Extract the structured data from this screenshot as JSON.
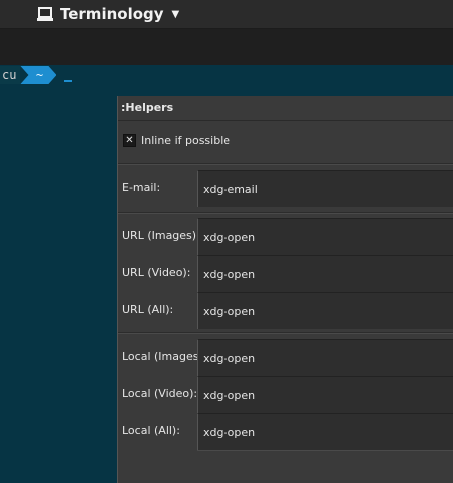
{
  "topbar": {
    "app_menu_label": "Terminology",
    "app_icon": "laptop-icon",
    "caret_icon": "chevron-down-icon"
  },
  "terminal": {
    "prompt_user": "cu",
    "prompt_dir": "~",
    "cursor_glyph": "_",
    "colors": {
      "background": "#063444",
      "accent": "#1e8ed0"
    }
  },
  "helpers": {
    "title": ":Helpers",
    "inline_checkbox": {
      "label": "Inline if possible",
      "checked": true
    },
    "email": {
      "label": "E-mail:",
      "value": "xdg-email"
    },
    "url_images": {
      "label": "URL (Images):",
      "value": "xdg-open"
    },
    "url_video": {
      "label": "URL (Video):",
      "value": "xdg-open"
    },
    "url_all": {
      "label": "URL (All):",
      "value": "xdg-open"
    },
    "local_images": {
      "label": "Local (Images):",
      "value": "xdg-open"
    },
    "local_video": {
      "label": "Local (Video):",
      "value": "xdg-open"
    },
    "local_all": {
      "label": "Local (All):",
      "value": "xdg-open"
    }
  }
}
